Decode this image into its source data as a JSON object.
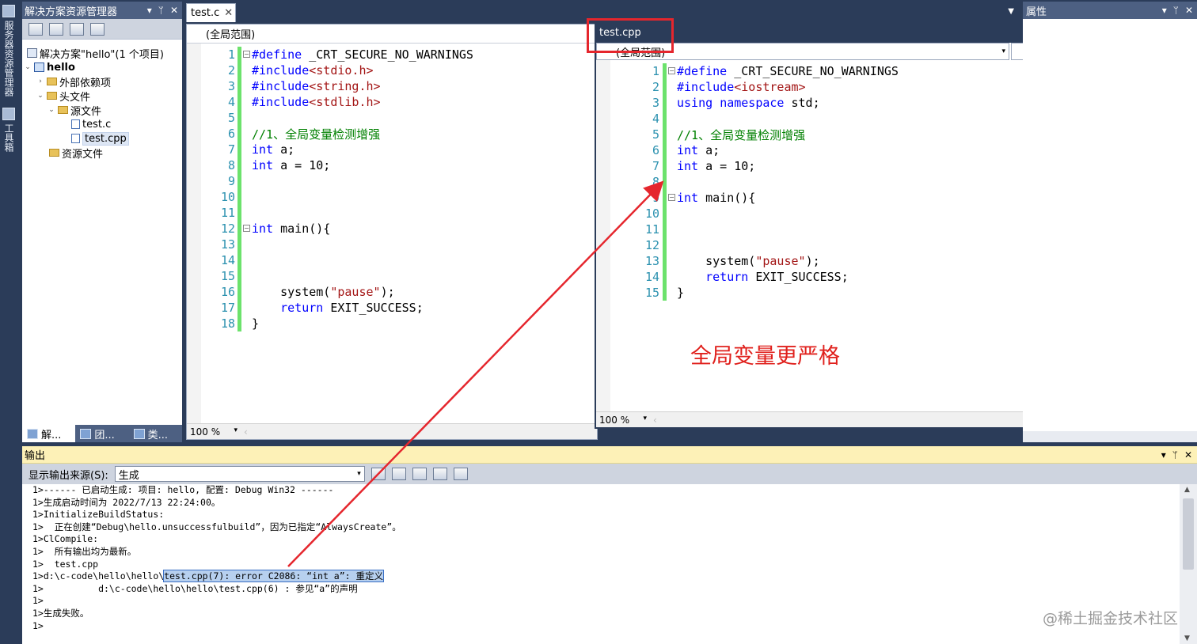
{
  "side_strip": {
    "server_explorer": "服务器资源管理器",
    "toolbox": "工具箱"
  },
  "solution_explorer": {
    "title": "解决方案资源管理器",
    "tree": {
      "solution": "解决方案\"hello\"(1 个项目)",
      "project": "hello",
      "external_deps": "外部依赖项",
      "headers": "头文件",
      "sources": "源文件",
      "file_c": "test.c",
      "file_cpp": "test.cpp",
      "resources": "资源文件"
    },
    "tabs": [
      "解...",
      "团...",
      "类..."
    ]
  },
  "left_editor": {
    "tab_label": "test.c",
    "scope": "(全局范围)",
    "zoom": "100 %",
    "lines": [
      {
        "n": "1",
        "segs": [
          [
            "pp",
            "#define"
          ],
          [
            "",
            " _CRT_SECURE_NO_WARNINGS"
          ]
        ]
      },
      {
        "n": "2",
        "segs": [
          [
            "pp",
            "#include"
          ],
          [
            "ang",
            "<stdio.h>"
          ]
        ]
      },
      {
        "n": "3",
        "segs": [
          [
            "pp",
            "#include"
          ],
          [
            "ang",
            "<string.h>"
          ]
        ]
      },
      {
        "n": "4",
        "segs": [
          [
            "pp",
            "#include"
          ],
          [
            "ang",
            "<stdlib.h>"
          ]
        ]
      },
      {
        "n": "5",
        "segs": []
      },
      {
        "n": "6",
        "segs": [
          [
            "cm",
            "//1、全局变量检测增强"
          ]
        ]
      },
      {
        "n": "7",
        "segs": [
          [
            "kw",
            "int"
          ],
          [
            "",
            " a;"
          ]
        ]
      },
      {
        "n": "8",
        "segs": [
          [
            "kw",
            "int"
          ],
          [
            "",
            " a = 10;"
          ]
        ]
      },
      {
        "n": "9",
        "segs": []
      },
      {
        "n": "10",
        "segs": []
      },
      {
        "n": "11",
        "segs": []
      },
      {
        "n": "12",
        "segs": [
          [
            "kw",
            "int"
          ],
          [
            "",
            " main(){"
          ]
        ]
      },
      {
        "n": "13",
        "segs": []
      },
      {
        "n": "14",
        "segs": []
      },
      {
        "n": "15",
        "segs": []
      },
      {
        "n": "16",
        "segs": [
          [
            "",
            "    system("
          ],
          [
            "str",
            "\"pause\""
          ],
          [
            "",
            ");"
          ]
        ]
      },
      {
        "n": "17",
        "segs": [
          [
            "",
            "    "
          ],
          [
            "kw",
            "return"
          ],
          [
            "",
            " EXIT_SUCCESS;"
          ]
        ]
      },
      {
        "n": "18",
        "segs": [
          [
            "",
            "}"
          ]
        ]
      }
    ]
  },
  "right_editor": {
    "tab_label": "test.cpp",
    "scope": "(全局范围)",
    "zoom": "100 %",
    "lines": [
      {
        "n": "1",
        "segs": [
          [
            "pp",
            "#define"
          ],
          [
            "",
            " _CRT_SECURE_NO_WARNINGS"
          ]
        ]
      },
      {
        "n": "2",
        "segs": [
          [
            "pp",
            "#include"
          ],
          [
            "ang",
            "<iostream>"
          ]
        ]
      },
      {
        "n": "3",
        "segs": [
          [
            "kw",
            "using"
          ],
          [
            "",
            " "
          ],
          [
            "kw",
            "namespace"
          ],
          [
            "",
            " std;"
          ]
        ]
      },
      {
        "n": "4",
        "segs": []
      },
      {
        "n": "5",
        "segs": [
          [
            "cm",
            "//1、全局变量检测增强"
          ]
        ]
      },
      {
        "n": "6",
        "segs": [
          [
            "kw",
            "int"
          ],
          [
            "",
            " a;"
          ]
        ]
      },
      {
        "n": "7",
        "segs": [
          [
            "kw",
            "int"
          ],
          [
            "",
            " a = 10;"
          ]
        ]
      },
      {
        "n": "8",
        "segs": []
      },
      {
        "n": "9",
        "segs": [
          [
            "kw",
            "int"
          ],
          [
            "",
            " main(){"
          ]
        ]
      },
      {
        "n": "10",
        "segs": []
      },
      {
        "n": "11",
        "segs": []
      },
      {
        "n": "12",
        "segs": []
      },
      {
        "n": "13",
        "segs": [
          [
            "",
            "    system("
          ],
          [
            "str",
            "\"pause\""
          ],
          [
            "",
            ");"
          ]
        ]
      },
      {
        "n": "14",
        "segs": [
          [
            "",
            "    "
          ],
          [
            "kw",
            "return"
          ],
          [
            "",
            " EXIT_SUCCESS;"
          ]
        ]
      },
      {
        "n": "15",
        "segs": [
          [
            "",
            "}"
          ]
        ]
      }
    ]
  },
  "properties": {
    "title": "属性"
  },
  "output": {
    "title": "输出",
    "source_label": "显示输出来源(S):",
    "source_value": "生成",
    "lines": [
      "1>------ 已启动生成: 项目: hello, 配置: Debug Win32 ------",
      "1>生成启动时间为 2022/7/13 22:24:00。",
      "1>InitializeBuildStatus:",
      "1>  正在创建“Debug\\hello.unsuccessfulbuild”，因为已指定“AlwaysCreate”。",
      "1>ClCompile:",
      "1>  所有输出均为最新。",
      "1>  test.cpp"
    ],
    "error_prefix": "1>d:\\c-code\\hello\\hello\\",
    "error_highlight": "test.cpp(7): error C2086: “int a”: 重定义",
    "lines_after": [
      "1>          d:\\c-code\\hello\\hello\\test.cpp(6) : 参见“a”的声明",
      "1>",
      "1>生成失败。",
      "1>"
    ]
  },
  "annotation": "全局变量更严格",
  "watermark": "@稀土掘金技术社区",
  "colors": {
    "accent_red": "#e5262d",
    "title_bar": "#4d6082",
    "output_title": "#fdf1b7"
  }
}
